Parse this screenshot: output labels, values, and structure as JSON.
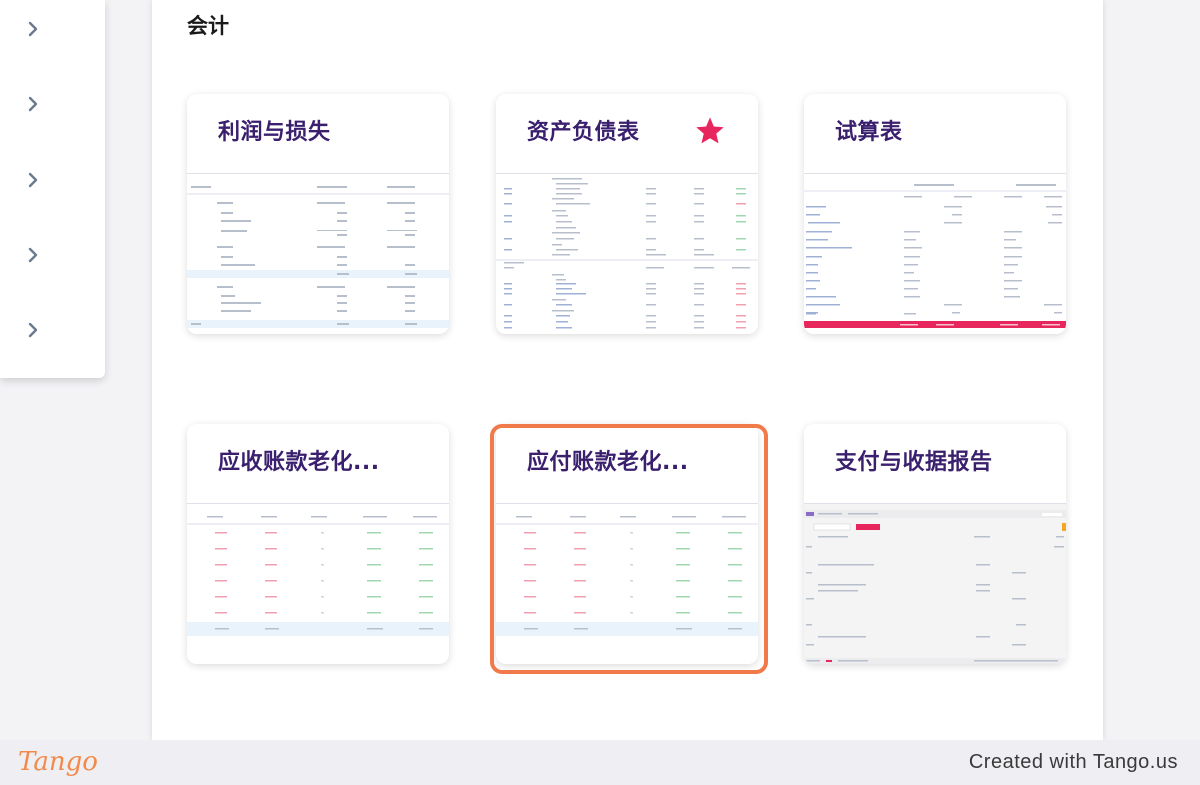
{
  "section": {
    "title": "会计"
  },
  "sidebar": {
    "items": [
      "chevron-right",
      "chevron-right",
      "chevron-right",
      "chevron-right",
      "chevron-right"
    ]
  },
  "cards": [
    {
      "title": "利润与损失",
      "preview": "table"
    },
    {
      "title": "资产负债表",
      "favorite": true,
      "preview": "table"
    },
    {
      "title": "试算表",
      "preview": "table"
    },
    {
      "title": "应收账款老化...",
      "preview": "aging"
    },
    {
      "title": "应付账款老化...",
      "preview": "aging",
      "highlighted": true
    },
    {
      "title": "支付与收据报告",
      "preview": "report"
    }
  ],
  "colors": {
    "accent": "#f07a4a",
    "title": "#3a1f6e",
    "star": "#e8265e",
    "band": "#e8f3fb"
  },
  "footer": {
    "logo": "Tango",
    "credit": "Created with Tango.us"
  }
}
